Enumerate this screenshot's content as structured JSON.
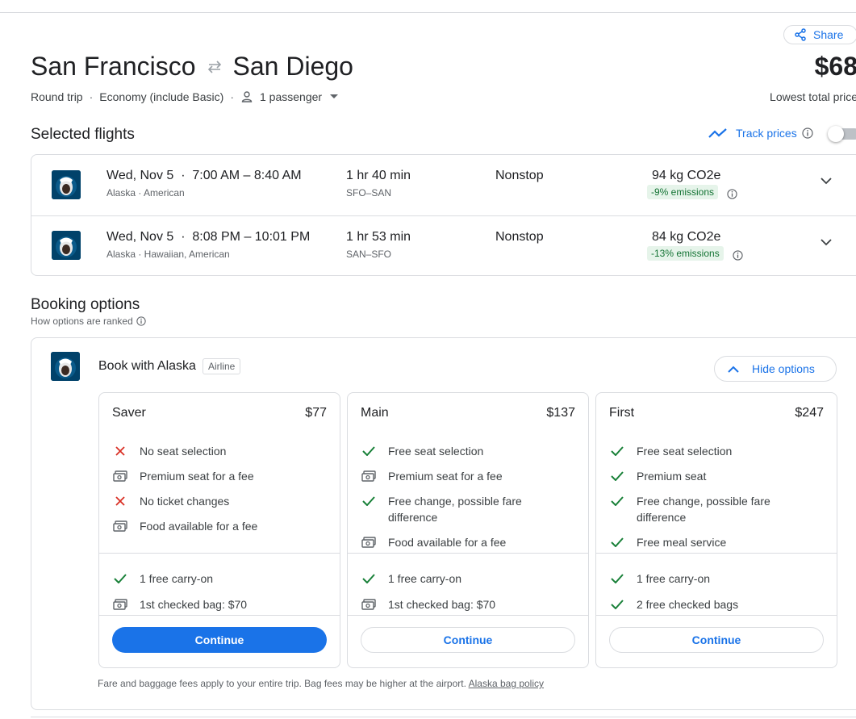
{
  "header": {
    "share_label": "Share",
    "origin": "San Francisco",
    "destination": "San Diego",
    "price": "$68",
    "price_caption": "Lowest total price",
    "trip_type": "Round trip",
    "cabin": "Economy (include Basic)",
    "passengers": "1 passenger"
  },
  "selected": {
    "title": "Selected flights",
    "track_label": "Track prices",
    "flights": [
      {
        "time": "Wed, Nov 5  ·  7:00 AM – 8:40 AM",
        "airlines": "Alaska · American",
        "duration": "1 hr 40 min",
        "route": "SFO–SAN",
        "stops": "Nonstop",
        "co2": "94 kg CO2e",
        "emissions": "-9% emissions"
      },
      {
        "time": "Wed, Nov 5  ·  8:08 PM – 10:01 PM",
        "airlines": "Alaska · Hawaiian, American",
        "duration": "1 hr 53 min",
        "route": "SAN–SFO",
        "stops": "Nonstop",
        "co2": "84 kg CO2e",
        "emissions": "-13% emissions"
      }
    ]
  },
  "booking": {
    "title": "Booking options",
    "ranked_label": "How options are ranked",
    "book_with": "Book with Alaska",
    "badge": "Airline",
    "hide_label": "Hide options",
    "fares": [
      {
        "name": "Saver",
        "price": "$77",
        "features": [
          {
            "icon": "x-icon",
            "text": "No seat selection"
          },
          {
            "icon": "fee-icon",
            "text": "Premium seat for a fee"
          },
          {
            "icon": "x-icon",
            "text": "No ticket changes"
          },
          {
            "icon": "fee-icon",
            "text": "Food available for a fee"
          }
        ],
        "bags": [
          {
            "icon": "check-icon",
            "text": "1 free carry-on"
          },
          {
            "icon": "fee-icon",
            "text": "1st checked bag: $70"
          }
        ],
        "button": "Continue"
      },
      {
        "name": "Main",
        "price": "$137",
        "features": [
          {
            "icon": "check-icon",
            "text": "Free seat selection"
          },
          {
            "icon": "fee-icon",
            "text": "Premium seat for a fee"
          },
          {
            "icon": "check-icon",
            "text": "Free change, possible fare difference"
          },
          {
            "icon": "fee-icon",
            "text": "Food available for a fee"
          }
        ],
        "bags": [
          {
            "icon": "check-icon",
            "text": "1 free carry-on"
          },
          {
            "icon": "fee-icon",
            "text": "1st checked bag: $70"
          }
        ],
        "button": "Continue"
      },
      {
        "name": "First",
        "price": "$247",
        "features": [
          {
            "icon": "check-icon",
            "text": "Free seat selection"
          },
          {
            "icon": "check-icon",
            "text": "Premium seat"
          },
          {
            "icon": "check-icon",
            "text": "Free change, possible fare difference"
          },
          {
            "icon": "check-icon",
            "text": "Free meal service"
          }
        ],
        "bags": [
          {
            "icon": "check-icon",
            "text": "1 free carry-on"
          },
          {
            "icon": "check-icon",
            "text": "2 free checked bags"
          }
        ],
        "button": "Continue"
      }
    ],
    "footnote": "Fare and baggage fees apply to your entire trip. Bag fees may be higher at the airport.",
    "bag_policy_link": "Alaska bag policy"
  },
  "colors": {
    "accent": "#1a73e8",
    "check": "#188038",
    "x": "#d93025",
    "emissions_bg": "#e6f4ea",
    "emissions_text": "#137333",
    "alaska_navy": "#01426a"
  }
}
